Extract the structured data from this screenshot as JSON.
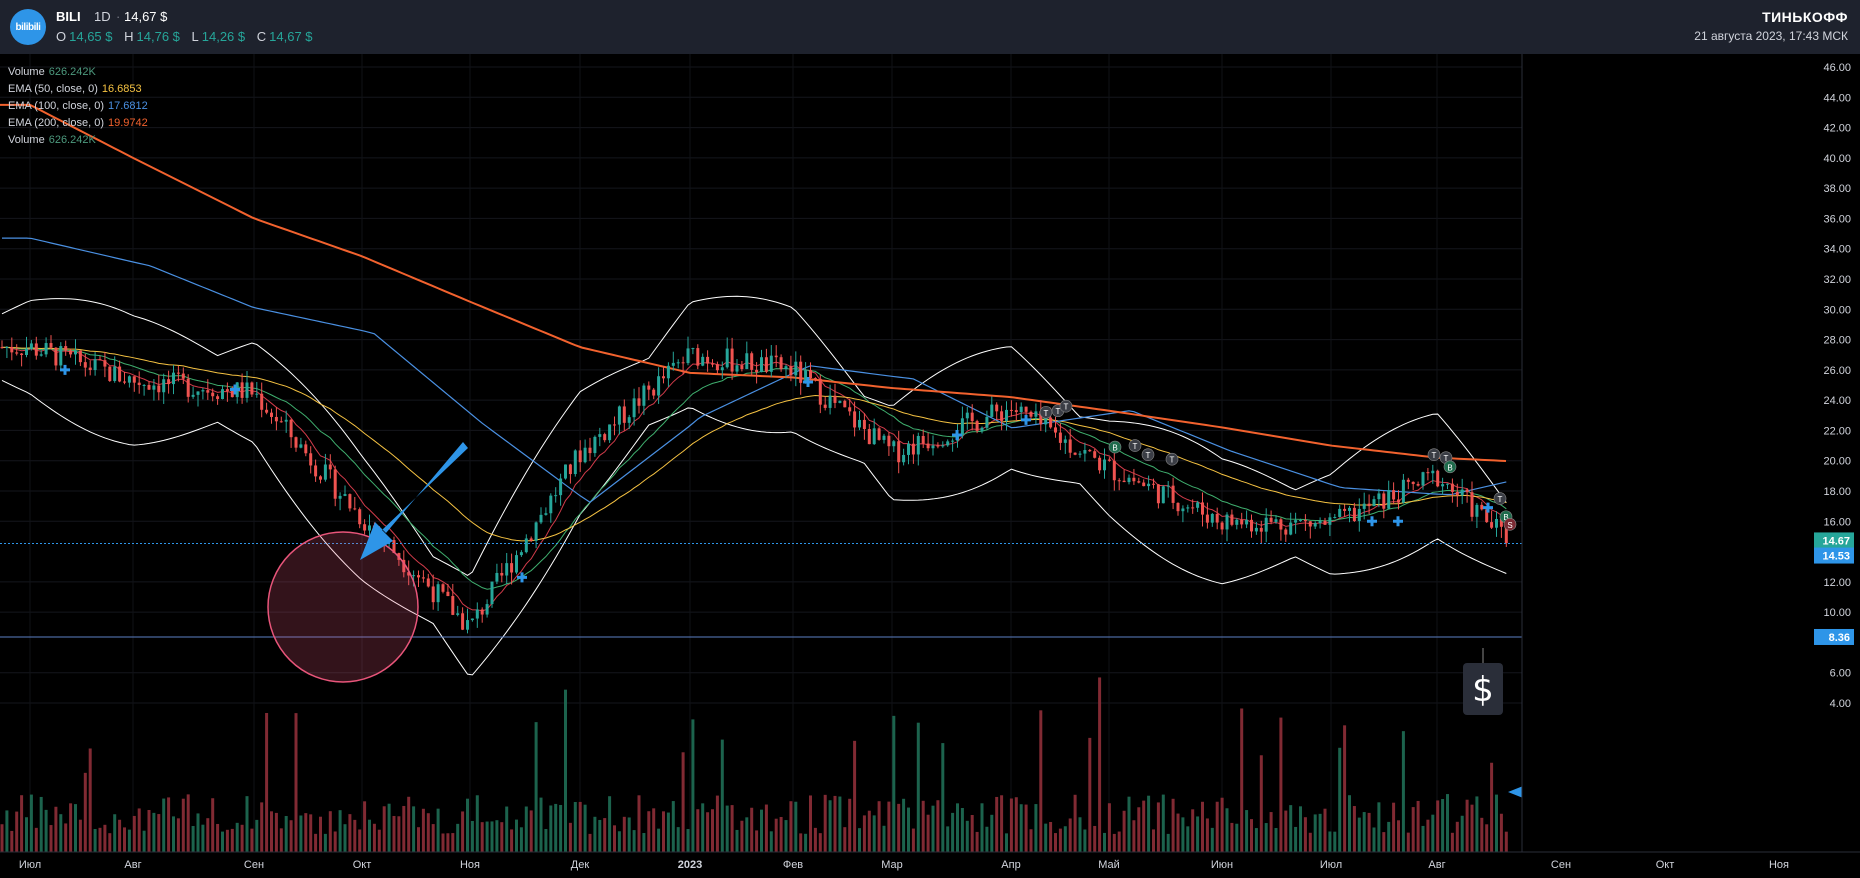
{
  "header": {
    "ticker": "BILI",
    "interval": "1D",
    "separator": "·",
    "price": "14,67 $",
    "logo_text": "bilibili",
    "ohlc": [
      {
        "k": "O",
        "v": "14,65 $"
      },
      {
        "k": "H",
        "v": "14,76 $"
      },
      {
        "k": "L",
        "v": "14,26 $"
      },
      {
        "k": "C",
        "v": "14,67 $"
      }
    ],
    "brand": "ТИНЬКОФФ",
    "datetime": "21 августа 2023, 17:43 МСК"
  },
  "legend": [
    {
      "name": "Volume",
      "value": "626.242K",
      "color": "#4d9a7e"
    },
    {
      "name": "EMA (50, close, 0)",
      "value": "16.6853",
      "color": "#f5c242"
    },
    {
      "name": "EMA (100, close, 0)",
      "value": "17.6812",
      "color": "#4a90e2"
    },
    {
      "name": "EMA (200, close, 0)",
      "value": "19.9742",
      "color": "#f2622e"
    },
    {
      "name": "Volume",
      "value": "626.242K",
      "color": "#4d9a7e"
    }
  ],
  "colors": {
    "up": "#26a69a",
    "down": "#ef5350",
    "ema50": "#f5c242",
    "ema100": "#4a90e2",
    "ema200": "#f2622e",
    "bands": "#ffffff",
    "arrow": "#2e95e8",
    "circle": "#e8557a"
  },
  "chart_data": {
    "type": "candlestick",
    "y_ticks": [
      "46.00",
      "44.00",
      "42.00",
      "40.00",
      "38.00",
      "36.00",
      "34.00",
      "32.00",
      "30.00",
      "28.00",
      "26.00",
      "24.00",
      "22.00",
      "20.00",
      "18.00",
      "16.00",
      "12.00",
      "10.00",
      "6.00",
      "4.00"
    ],
    "ylim": [
      3,
      47
    ],
    "x_ticks": [
      "Июл",
      "Авг",
      "Сен",
      "Окт",
      "Ноя",
      "Дек",
      "2023",
      "Фев",
      "Мар",
      "Апр",
      "Май",
      "Июн",
      "Июл",
      "Авг",
      "Сен",
      "Окт",
      "Ноя"
    ],
    "price_tags": [
      {
        "label": "14.67",
        "value": 14.67,
        "color": "#26a69a"
      },
      {
        "label": "14.53",
        "value": 14.53,
        "color": "#2e95e8"
      },
      {
        "label": "8.36",
        "value": 8.36,
        "color": "#2e95e8"
      }
    ],
    "close_path": [
      {
        "t": "Июл",
        "v": 27.5
      },
      {
        "t": "Авг",
        "v": 25.3
      },
      {
        "t": "Сен",
        "v": 24.5
      },
      {
        "t": "Окт",
        "v": 16.2
      },
      {
        "t": "Ноя",
        "v": 9.0
      },
      {
        "t": "Дек",
        "v": 20.5
      },
      {
        "t": "2023",
        "v": 27.0
      },
      {
        "t": "Фев",
        "v": 26.0
      },
      {
        "t": "Мар",
        "v": 20.5
      },
      {
        "t": "Апр",
        "v": 23.5
      },
      {
        "t": "Май",
        "v": 19.5
      },
      {
        "t": "Июн",
        "v": 16.0
      },
      {
        "t": "Июл",
        "v": 15.8
      },
      {
        "t": "Авг",
        "v": 19.0
      },
      {
        "t": "Авг",
        "v": 14.67
      }
    ],
    "ema200_path": [
      {
        "t": "Июл",
        "v": 43.5
      },
      {
        "t": "Авг",
        "v": 40.0
      },
      {
        "t": "Сен",
        "v": 36.0
      },
      {
        "t": "Окт",
        "v": 33.5
      },
      {
        "t": "Ноя",
        "v": 30.5
      },
      {
        "t": "Дек",
        "v": 27.5
      },
      {
        "t": "2023",
        "v": 25.8
      },
      {
        "t": "Фев",
        "v": 25.5
      },
      {
        "t": "Мар",
        "v": 24.8
      },
      {
        "t": "Апр",
        "v": 24.2
      },
      {
        "t": "Май",
        "v": 23.3
      },
      {
        "t": "Июн",
        "v": 22.2
      },
      {
        "t": "Июл",
        "v": 21.0
      },
      {
        "t": "Авг",
        "v": 20.2
      },
      {
        "t": "Авг",
        "v": 19.97
      }
    ],
    "markers": {
      "trade_badges": [
        "T",
        "B",
        "S"
      ],
      "dividend_icon": "$"
    }
  }
}
